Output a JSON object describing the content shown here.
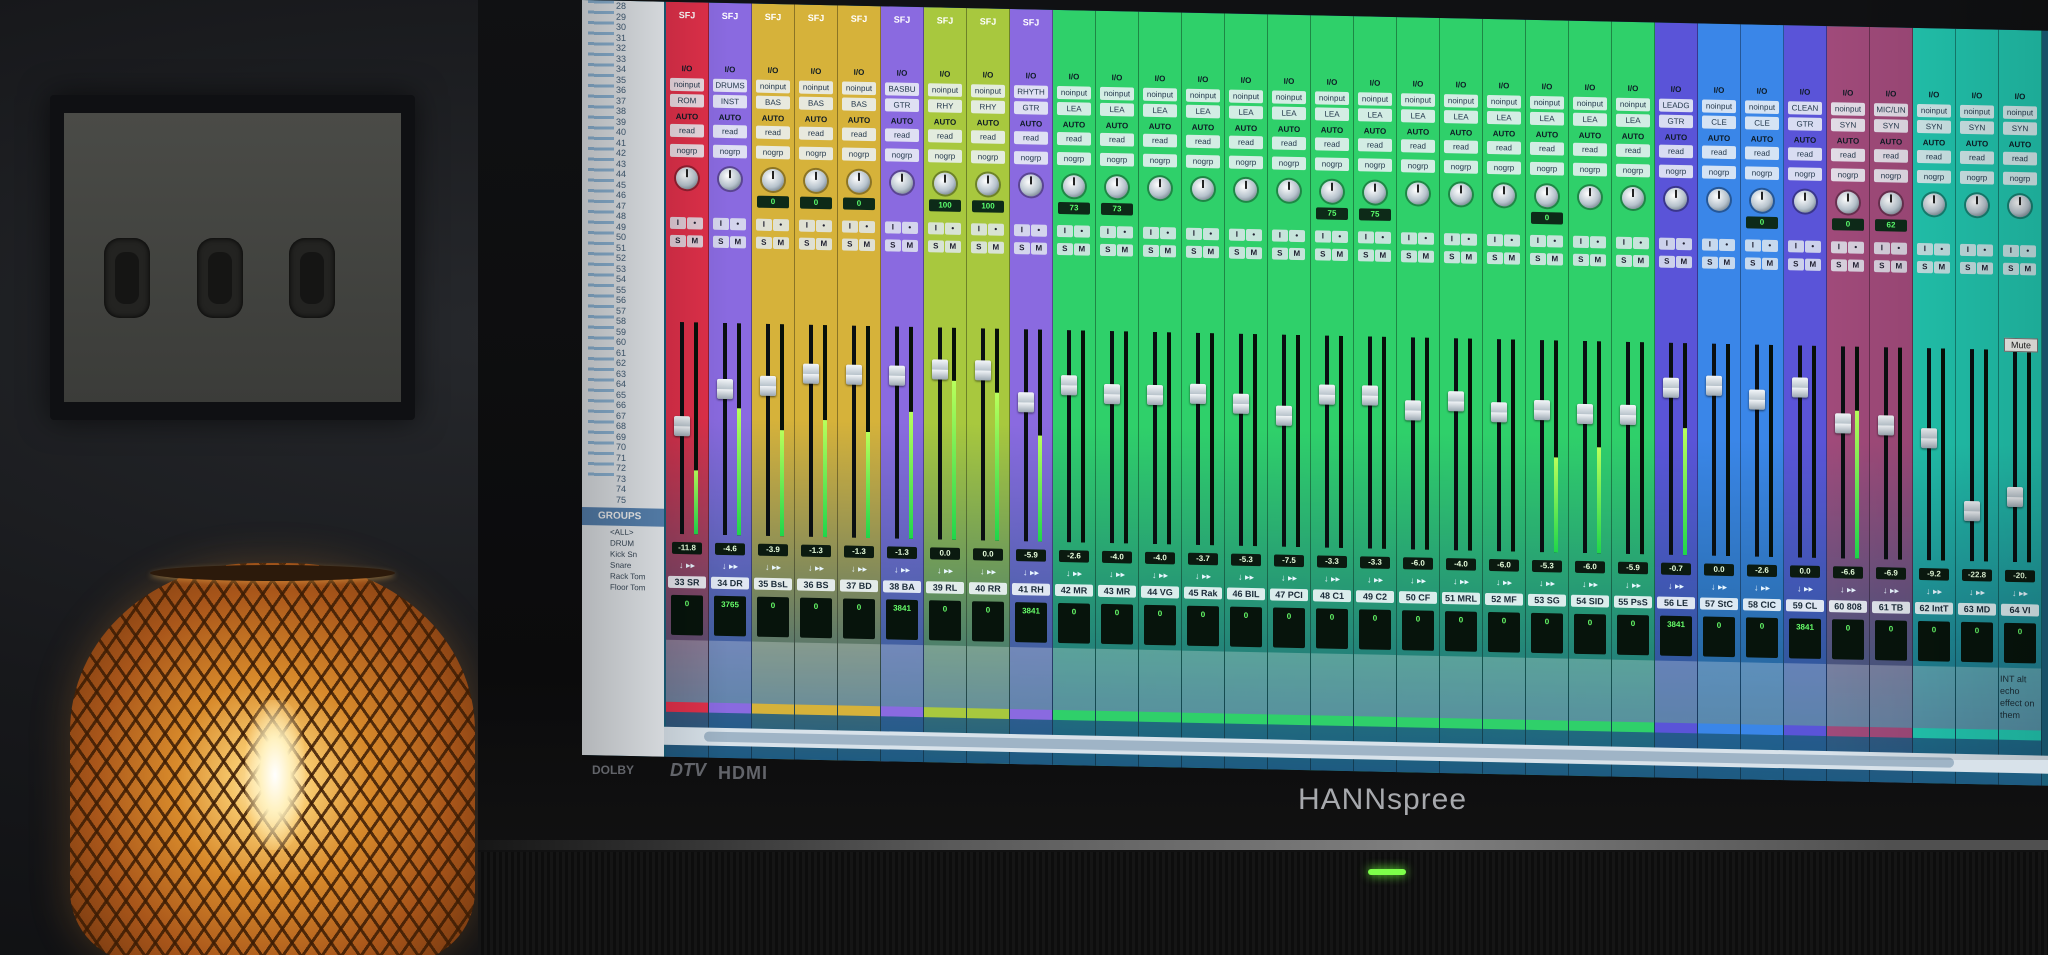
{
  "monitor": {
    "brand": "HANNspree",
    "badges": [
      "DOLBY",
      "DTV",
      "HDMI"
    ]
  },
  "track_list": {
    "numbers": [
      "28",
      "29",
      "30",
      "31",
      "32",
      "33",
      "34",
      "35",
      "36",
      "37",
      "38",
      "39",
      "40",
      "41",
      "42",
      "43",
      "44",
      "45",
      "46",
      "47",
      "48",
      "49",
      "50",
      "51",
      "52",
      "53",
      "54",
      "55",
      "56",
      "57",
      "58",
      "59",
      "60",
      "61",
      "62",
      "63",
      "64",
      "65",
      "66",
      "67",
      "68",
      "69",
      "70",
      "71",
      "72",
      "73",
      "74",
      "75"
    ],
    "groups_header": "GROUPS",
    "groups": [
      "<ALL>",
      "DRUM",
      "Kick Sn",
      "Snare",
      "Rack Tom",
      "Floor Tom"
    ]
  },
  "mute_tooltip": "Mute",
  "comment_51": "INT alt echo effect on them",
  "colors": {
    "red": "#e0304a",
    "violet": "#8a6ae0",
    "gold": "#d6b23a",
    "olive": "#a8c83e",
    "green": "#2fd06a",
    "teal": "#22c7b0",
    "blue": "#3a86e8",
    "indigo": "#5a54d8",
    "plum": "#a04a7a"
  },
  "channels": [
    {
      "name": "33 SR",
      "top": "SFJ",
      "input": "noinput",
      "output": "ROM",
      "auto": "read",
      "vol": "-11.8",
      "color": "red",
      "counter": "0",
      "meter": 0.3
    },
    {
      "name": "34 DR",
      "top": "SFJ",
      "input": "DRUMS",
      "output": "INST",
      "auto": "read",
      "vol": "-4.6",
      "color": "violet",
      "counter": "3765",
      "meter": 0.6
    },
    {
      "name": "35 BsL",
      "top": "SFJ",
      "input": "noinput",
      "output": "BAS",
      "auto": "read",
      "vol": "-3.9",
      "color": "gold",
      "pan": "0",
      "counter": "0",
      "meter": 0.5
    },
    {
      "name": "36 BS",
      "top": "SFJ",
      "input": "noinput",
      "output": "BAS",
      "auto": "read",
      "vol": "-1.3",
      "color": "gold",
      "pan": "0",
      "counter": "0",
      "meter": 0.55
    },
    {
      "name": "37 BD",
      "top": "SFJ",
      "input": "noinput",
      "output": "BAS",
      "auto": "read",
      "vol": "-1.3",
      "color": "gold",
      "pan": "0",
      "counter": "0",
      "meter": 0.5
    },
    {
      "name": "38 BA",
      "top": "SFJ",
      "input": "BASBU",
      "output": "GTR",
      "auto": "read",
      "vol": "-1.3",
      "color": "violet",
      "counter": "3841",
      "meter": 0.6
    },
    {
      "name": "39 RL",
      "top": "SFJ",
      "input": "noinput",
      "output": "RHY",
      "auto": "read",
      "vol": "0.0",
      "color": "olive",
      "pan": "100",
      "counter": "0",
      "meter": 0.75
    },
    {
      "name": "40 RR",
      "top": "SFJ",
      "input": "noinput",
      "output": "RHY",
      "auto": "read",
      "vol": "0.0",
      "color": "olive",
      "pan": "100",
      "counter": "0",
      "meter": 0.7
    },
    {
      "name": "41 RH",
      "top": "SFJ",
      "input": "RHYTH",
      "output": "GTR",
      "auto": "read",
      "vol": "-5.9",
      "color": "violet",
      "counter": "3841",
      "meter": 0.5
    },
    {
      "name": "42 MR",
      "top": "",
      "input": "noinput",
      "output": "LEA",
      "auto": "read",
      "vol": "-2.6",
      "color": "green",
      "pan": "73",
      "counter": "0",
      "meter": 0
    },
    {
      "name": "43 MR",
      "top": "",
      "input": "noinput",
      "output": "LEA",
      "auto": "read",
      "vol": "-4.0",
      "color": "green",
      "pan": "73",
      "counter": "0",
      "meter": 0
    },
    {
      "name": "44 VG",
      "top": "",
      "input": "noinput",
      "output": "LEA",
      "auto": "read",
      "vol": "-4.0",
      "color": "green",
      "counter": "0",
      "meter": 0
    },
    {
      "name": "45 Rak",
      "top": "",
      "input": "noinput",
      "output": "LEA",
      "auto": "read",
      "vol": "-3.7",
      "color": "green",
      "counter": "0",
      "meter": 0
    },
    {
      "name": "46 BIL",
      "top": "",
      "input": "noinput",
      "output": "LEA",
      "auto": "read",
      "vol": "-5.3",
      "color": "green",
      "counter": "0",
      "meter": 0
    },
    {
      "name": "47 PCI",
      "top": "",
      "input": "noinput",
      "output": "LEA",
      "auto": "read",
      "vol": "-7.5",
      "color": "green",
      "counter": "0",
      "meter": 0
    },
    {
      "name": "48 C1",
      "top": "",
      "input": "noinput",
      "output": "LEA",
      "auto": "read",
      "vol": "-3.3",
      "color": "green",
      "pan": "75",
      "counter": "0",
      "meter": 0
    },
    {
      "name": "49 C2",
      "top": "",
      "input": "noinput",
      "output": "LEA",
      "auto": "read",
      "vol": "-3.3",
      "color": "green",
      "pan": "75",
      "counter": "0",
      "meter": 0
    },
    {
      "name": "50 CF",
      "top": "",
      "input": "noinput",
      "output": "LEA",
      "auto": "read",
      "vol": "-6.0",
      "color": "green",
      "counter": "0",
      "meter": 0
    },
    {
      "name": "51 MRL",
      "top": "",
      "input": "noinput",
      "output": "LEA",
      "auto": "read",
      "vol": "-4.0",
      "color": "green",
      "counter": "0",
      "meter": 0
    },
    {
      "name": "52 MF",
      "top": "",
      "input": "noinput",
      "output": "LEA",
      "auto": "read",
      "vol": "-6.0",
      "color": "green",
      "counter": "0",
      "meter": 0
    },
    {
      "name": "53 SG",
      "top": "",
      "input": "noinput",
      "output": "LEA",
      "auto": "read",
      "vol": "-5.3",
      "color": "green",
      "pan": "0",
      "counter": "0",
      "meter": 0.45
    },
    {
      "name": "54 SID",
      "top": "",
      "input": "noinput",
      "output": "LEA",
      "auto": "read",
      "vol": "-6.0",
      "color": "green",
      "counter": "0",
      "meter": 0.5
    },
    {
      "name": "55 PsS",
      "top": "",
      "input": "noinput",
      "output": "LEA",
      "auto": "read",
      "vol": "-5.9",
      "color": "green",
      "counter": "0",
      "meter": 0
    },
    {
      "name": "56 LE",
      "top": "",
      "input": "LEADG",
      "output": "GTR",
      "auto": "read",
      "vol": "-0.7",
      "color": "indigo",
      "counter": "3841",
      "meter": 0.6
    },
    {
      "name": "57 StC",
      "top": "",
      "input": "noinput",
      "output": "CLE",
      "auto": "read",
      "vol": "0.0",
      "color": "blue",
      "counter": "0",
      "meter": 0
    },
    {
      "name": "58 CIC",
      "top": "",
      "input": "noinput",
      "output": "CLE",
      "auto": "read",
      "vol": "-2.6",
      "color": "blue",
      "pan": "0",
      "counter": "0",
      "meter": 0
    },
    {
      "name": "59 CL",
      "top": "",
      "input": "CLEAN",
      "output": "GTR",
      "auto": "read",
      "vol": "0.0",
      "color": "indigo",
      "counter": "3841",
      "meter": 0
    },
    {
      "name": "60 808",
      "top": "",
      "input": "noinput",
      "output": "SYN",
      "auto": "read",
      "vol": "-6.6",
      "color": "plum",
      "pan": "0",
      "counter": "0",
      "meter": 0.7
    },
    {
      "name": "61 TB",
      "top": "",
      "input": "MIC/LIN",
      "output": "SYN",
      "auto": "read",
      "vol": "-6.9",
      "color": "plum",
      "pan": "62",
      "counter": "0",
      "meter": 0
    },
    {
      "name": "62 IntT",
      "top": "",
      "input": "noinput",
      "output": "SYN",
      "auto": "read",
      "vol": "-9.2",
      "color": "teal",
      "counter": "0",
      "meter": 0
    },
    {
      "name": "63 MD",
      "top": "",
      "input": "noinput",
      "output": "SYN",
      "auto": "read",
      "vol": "-22.8",
      "color": "teal",
      "counter": "0",
      "meter": 0
    },
    {
      "name": "64 VI",
      "top": "",
      "input": "noinput",
      "output": "SYN",
      "auto": "read",
      "vol": "-20.",
      "color": "teal",
      "counter": "0",
      "meter": 0
    }
  ]
}
